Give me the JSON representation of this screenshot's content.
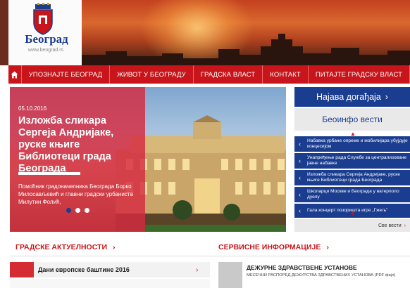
{
  "header": {
    "logo_text": "Београд",
    "logo_url": "www.beograd.rs"
  },
  "nav": {
    "items": [
      {
        "label": "УПОЗНАЈТЕ БЕОГРАД"
      },
      {
        "label": "ЖИВОТ У БЕОГРАДУ"
      },
      {
        "label": "ГРАДСКА ВЛАСТ"
      },
      {
        "label": "КОНТАКТ"
      },
      {
        "label": "ПИТАЈТЕ ГРАДСКУ ВЛАСТ"
      }
    ]
  },
  "hero": {
    "date": "05.10.2016",
    "title": "Изложба сликара Сергеја Андријаке, руске књиге Библиотеци града Београда",
    "description": "Помоћник градоначелника Београда Борко Милосављевић и главни градски урбаниста Милутин Фолић,",
    "active_slide": 1,
    "slide_count": 3
  },
  "right_panel": {
    "najava_label": "Најава догађаја",
    "beoinfo_label": "Беоинфо вести",
    "news": [
      "Набавка урбане опреме и мобилијара убујдује концесијом",
      "Унапређење рада Службе за централизоване јавне набавке",
      "Изложба сликара Сергеја Андријаке, руске књиге Библиотеци града Београда",
      "Школарци Москве и Београда у ватерполо дуелу",
      "Гала концерт позоришта игре „Гжељ\""
    ],
    "all_news_label": "Све вести"
  },
  "sections": {
    "left_title": "ГРАДСКЕ АКТУЕЛНОСТИ",
    "right_title": "СЕРВИСНЕ ИНФОРМАЦИЈЕ",
    "left_row_text": "Дани европске баштине 2016",
    "right_row_title": "ДЕЖУРНЕ ЗДРАВСТВЕНЕ УСТАНОВЕ",
    "right_row_sub": "МЕСЕЧНИ РАСПОРЕД ДЕЖУРСТВА ЗДРАВСТВЕНИХ УСТАНОВА (PDF фајл)"
  },
  "colors": {
    "brand_red": "#c8151b",
    "brand_blue": "#1b3d8f",
    "hero_overlay": "#d62940"
  },
  "icons": {
    "home": "home-icon",
    "chevron": "chevron-right-icon"
  }
}
